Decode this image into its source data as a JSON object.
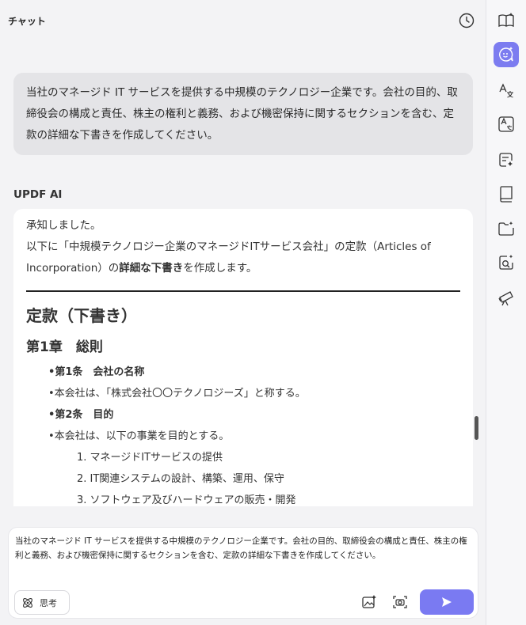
{
  "header": {
    "title": "チャット"
  },
  "user_message": "当社のマネージド IT サービスを提供する中規模のテクノロジー企業です。会社の目的、取締役会の構成と責任、株主の権利と義務、および機密保持に関するセクションを含む、定款の詳細な下書きを作成してください。",
  "assistant": {
    "name": "UPDF AI",
    "intro_line1": "承知しました。",
    "intro_line2_a": "以下に「中規模テクノロジー企業のマネージドITサービス会社」の定款（Articles of Incorporation）の",
    "intro_line2_bold": "詳細な下書き",
    "intro_line2_b": "を作成します。",
    "heading1": "定款（下書き）",
    "heading2": "第1章　総則",
    "items": [
      {
        "text": "第1条　会社の名称",
        "bold": true
      },
      {
        "text": "本会社は、「株式会社〇〇テクノロジーズ」と称する。",
        "bold": false
      },
      {
        "text": "第2条　目的",
        "bold": true
      },
      {
        "text": "本会社は、以下の事業を目的とする。",
        "bold": false
      }
    ],
    "numbered": [
      "1. マネージドITサービスの提供",
      "2. IT関連システムの設計、構築、運用、保守",
      "3. ソフトウェア及びハードウェアの販売・開発"
    ]
  },
  "composer": {
    "value": "当社のマネージド IT サービスを提供する中規模のテクノロジー企業です。会社の目的、取締役会の構成と責任、株主の権利と義務、および機密保持に関するセクションを含む、定款の詳細な下書きを作成してください。",
    "think_label": "思考"
  },
  "colors": {
    "accent": "#7a7af2",
    "bubble": "#e4e4e7",
    "background": "#f3f3f5"
  },
  "icons": {
    "header": "history-icon",
    "rail": [
      "book-open-icon",
      "ai-chat-icon",
      "translate-icon",
      "translate-doc-icon",
      "summary-icon",
      "book-icon",
      "folder-icon",
      "search-ai-icon",
      "telescope-icon"
    ],
    "composer": [
      "atom-icon",
      "image-ai-icon",
      "screenshot-icon",
      "send-icon"
    ]
  }
}
